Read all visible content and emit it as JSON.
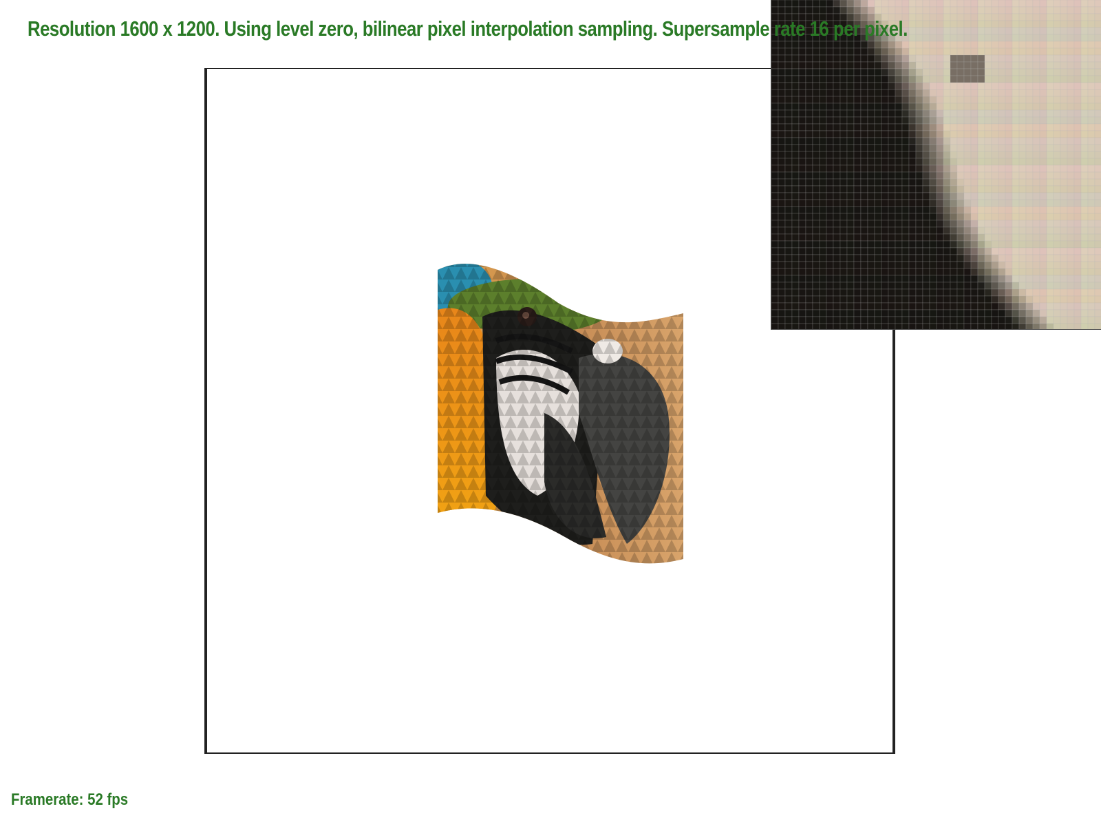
{
  "header": {
    "resolution_text": "Resolution 1600 x 1200. Using level zero, bilinear pixel interpolation sampling. Supersample rate 16 per pixel."
  },
  "footer": {
    "framerate_text": "Framerate: 52 fps"
  },
  "colors": {
    "text": "#2a7a26",
    "border": "#222222",
    "background": "#ffffff"
  },
  "viewport": {
    "content": "texture-mapped waving flag image (parrot)"
  },
  "zoom_inset": {
    "content": "magnified pixel grid of rendered texture"
  }
}
